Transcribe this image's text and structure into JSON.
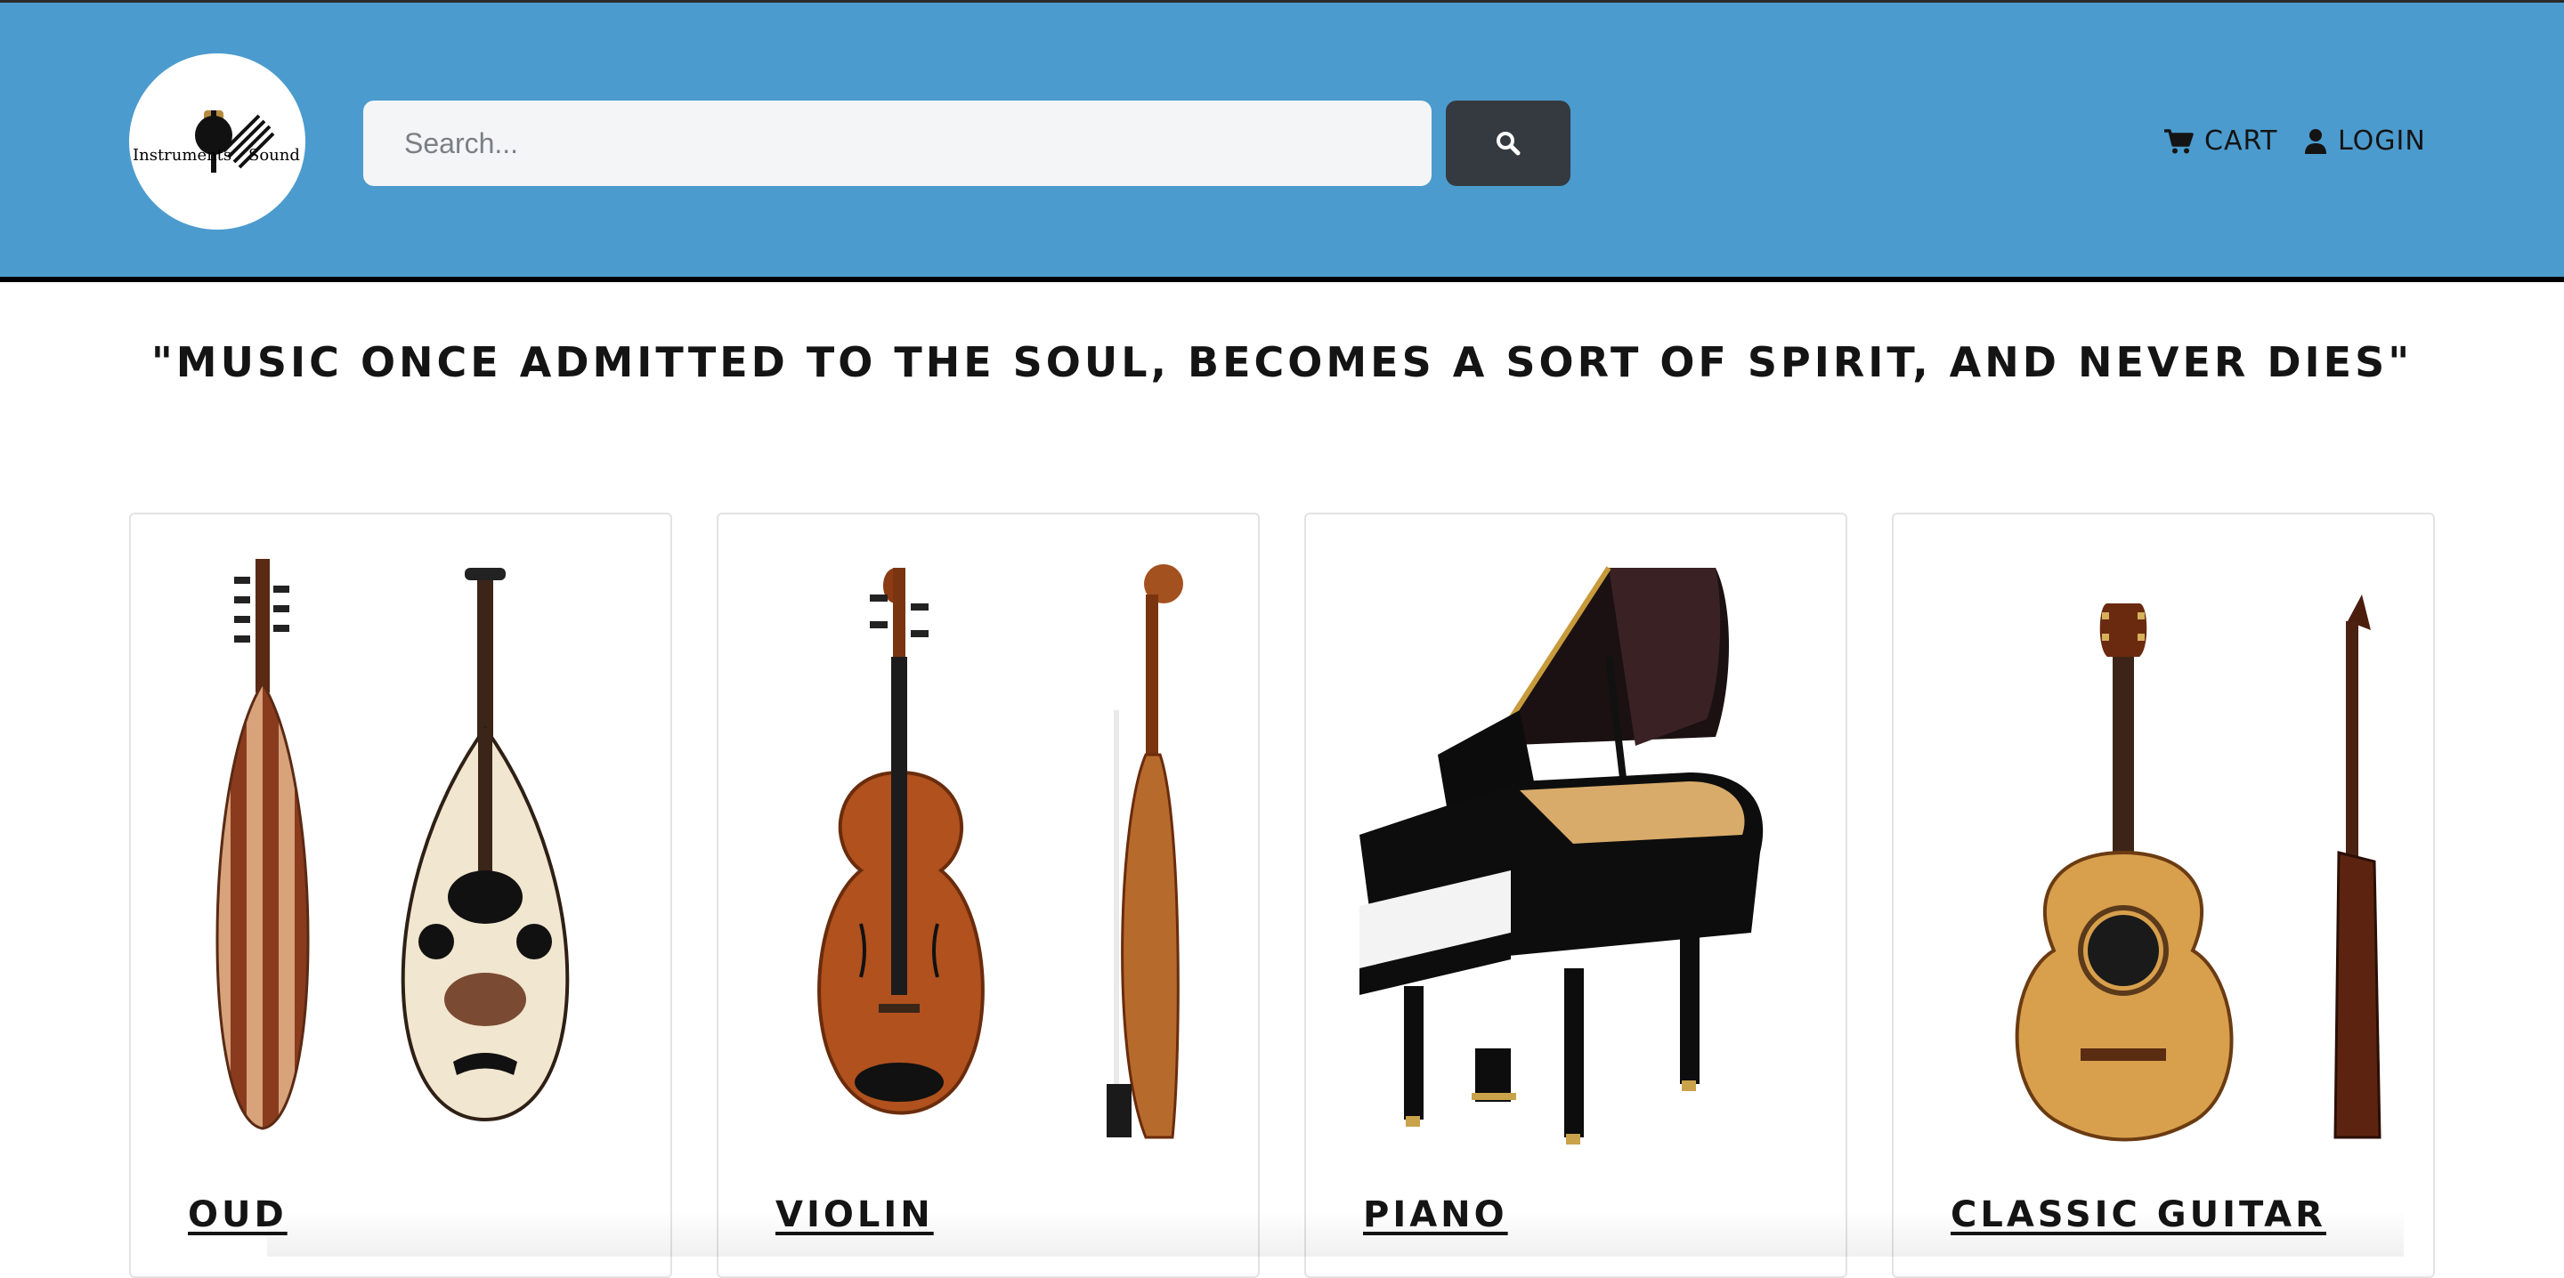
{
  "header": {
    "logo": {
      "text_left": "Instruments",
      "text_right": "Sound",
      "icon": "guitar-logo-icon"
    },
    "search": {
      "placeholder": "Search...",
      "value": "",
      "button_icon": "search-icon"
    },
    "nav": {
      "cart_label": "CART",
      "cart_icon": "cart-icon",
      "login_label": "LOGIN",
      "login_icon": "user-icon"
    }
  },
  "quote": "\"MUSIC ONCE ADMITTED TO THE SOUL, BECOMES A SORT OF SPIRIT, AND NEVER DIES\"",
  "products": [
    {
      "title": "OUD",
      "image": "oud-image"
    },
    {
      "title": "VIOLIN",
      "image": "violin-image"
    },
    {
      "title": "PIANO",
      "image": "piano-image"
    },
    {
      "title": "CLASSIC GUITAR",
      "image": "classic-guitar-image"
    }
  ],
  "colors": {
    "header_bg": "#4c9bce",
    "search_button_bg": "#343a40",
    "text": "#141414"
  }
}
